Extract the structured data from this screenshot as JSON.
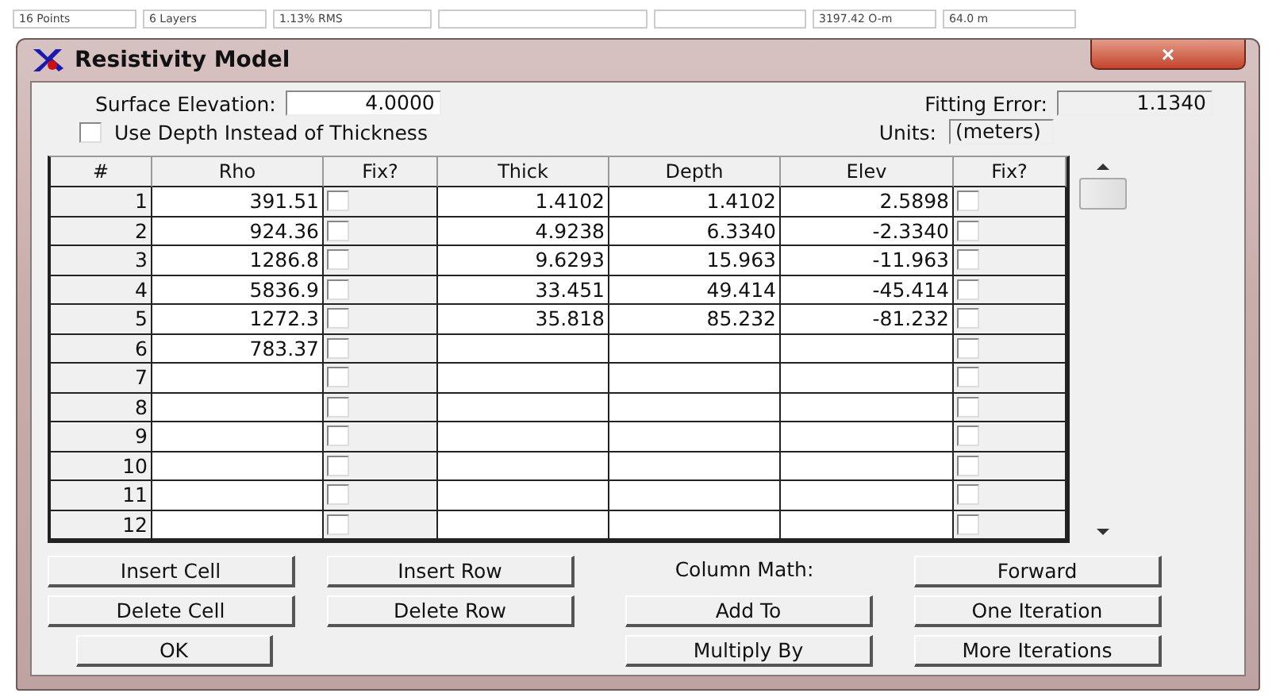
{
  "status_bar": [
    {
      "kind": "text",
      "text": "16 Points"
    },
    {
      "kind": "text",
      "text": "6 Layers"
    },
    {
      "kind": "text",
      "text": "1.13% RMS"
    },
    {
      "kind": "blank"
    },
    {
      "kind": "blank"
    },
    {
      "kind": "text",
      "text": "3197.42 O-m"
    },
    {
      "kind": "text",
      "text": "64.0 m"
    }
  ],
  "window": {
    "title": "Resistivity Model",
    "close": "×"
  },
  "surface_elevation": {
    "label": "Surface Elevation:",
    "value": "4.0000"
  },
  "fitting_error": {
    "label": "Fitting Error:",
    "value": "1.1340"
  },
  "use_depth": {
    "label": "Use Depth Instead of Thickness",
    "checked": false
  },
  "units": {
    "label": "Units:",
    "value": "(meters)"
  },
  "table": {
    "columns": [
      "#",
      "Rho",
      "Fix?",
      "Thick",
      "Depth",
      "Elev",
      "Fix?"
    ],
    "rows": [
      {
        "n": "1",
        "rho": "391.51",
        "fix_rho": false,
        "thick": "1.4102",
        "depth": "1.4102",
        "elev": "2.5898",
        "fix_elev": false
      },
      {
        "n": "2",
        "rho": "924.36",
        "fix_rho": false,
        "thick": "4.9238",
        "depth": "6.3340",
        "elev": "-2.3340",
        "fix_elev": false
      },
      {
        "n": "3",
        "rho": "1286.8",
        "fix_rho": false,
        "thick": "9.6293",
        "depth": "15.963",
        "elev": "-11.963",
        "fix_elev": false
      },
      {
        "n": "4",
        "rho": "5836.9",
        "fix_rho": false,
        "thick": "33.451",
        "depth": "49.414",
        "elev": "-45.414",
        "fix_elev": false
      },
      {
        "n": "5",
        "rho": "1272.3",
        "fix_rho": false,
        "thick": "35.818",
        "depth": "85.232",
        "elev": "-81.232",
        "fix_elev": false
      },
      {
        "n": "6",
        "rho": "783.37",
        "fix_rho": false,
        "fix_elev": false
      },
      {
        "n": "7",
        "fix_rho": false,
        "fix_elev": false
      },
      {
        "n": "8",
        "fix_rho": false,
        "fix_elev": false
      },
      {
        "n": "9",
        "fix_rho": false,
        "fix_elev": false
      },
      {
        "n": "10",
        "fix_rho": false,
        "fix_elev": false
      },
      {
        "n": "11",
        "fix_rho": false,
        "fix_elev": false
      },
      {
        "n": "12",
        "fix_rho": false,
        "fix_elev": false
      }
    ]
  },
  "buttons_left": [
    [
      "Insert Cell",
      "Insert Row"
    ],
    [
      "Delete Cell",
      "Delete Row"
    ],
    [
      "OK"
    ]
  ],
  "column_math": {
    "label": "Column Math:",
    "buttons": [
      "Add To",
      "Multiply By"
    ]
  },
  "run_buttons": [
    "Forward",
    "One Iteration",
    "More Iterations"
  ]
}
